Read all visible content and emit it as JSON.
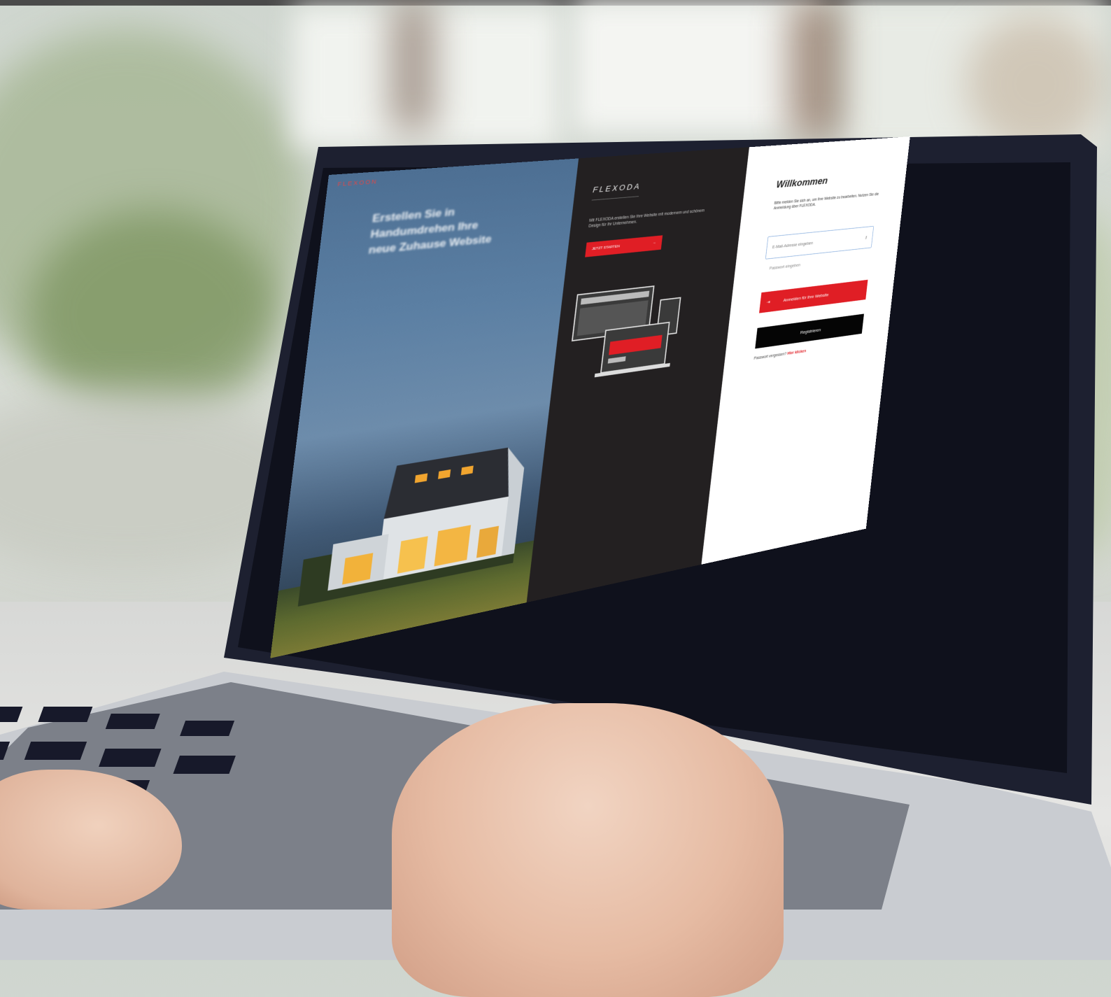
{
  "scene": {
    "description_colors": {
      "accent_red": "#e01e25",
      "dark_pane": "#232021",
      "sky_blue": "#5b7fa3"
    }
  },
  "screen": {
    "hero": {
      "logo": "FLEXOON",
      "headline": "Erstellen Sie in Handumdrehen Ihre neue Zuhause Website"
    },
    "dark_pane": {
      "brand": "FLEXODA",
      "description": "Mit FLEXODA erstellen Sie Ihre Website mit modernem und schönem Design für Ihr Unternehmen.",
      "cta_label": "JETZT STARTEN",
      "cta_icon": "arrow-right-icon"
    },
    "login": {
      "title": "Willkommen",
      "description": "Bitte melden Sie sich an, um Ihre Website zu bearbeiten. Nutzen Sie die Anmeldung über FLEXODA.",
      "email_placeholder": "E-Mail-Adresse eingeben",
      "email_icon": "key-icon",
      "password_placeholder": "Passwort eingeben",
      "login_label": "Anmelden für Ihre Website",
      "login_icon": "login-icon",
      "register_label": "Registrieren",
      "forgot_text": "Passwort vergessen?",
      "forgot_link": "Hier klicken"
    }
  }
}
